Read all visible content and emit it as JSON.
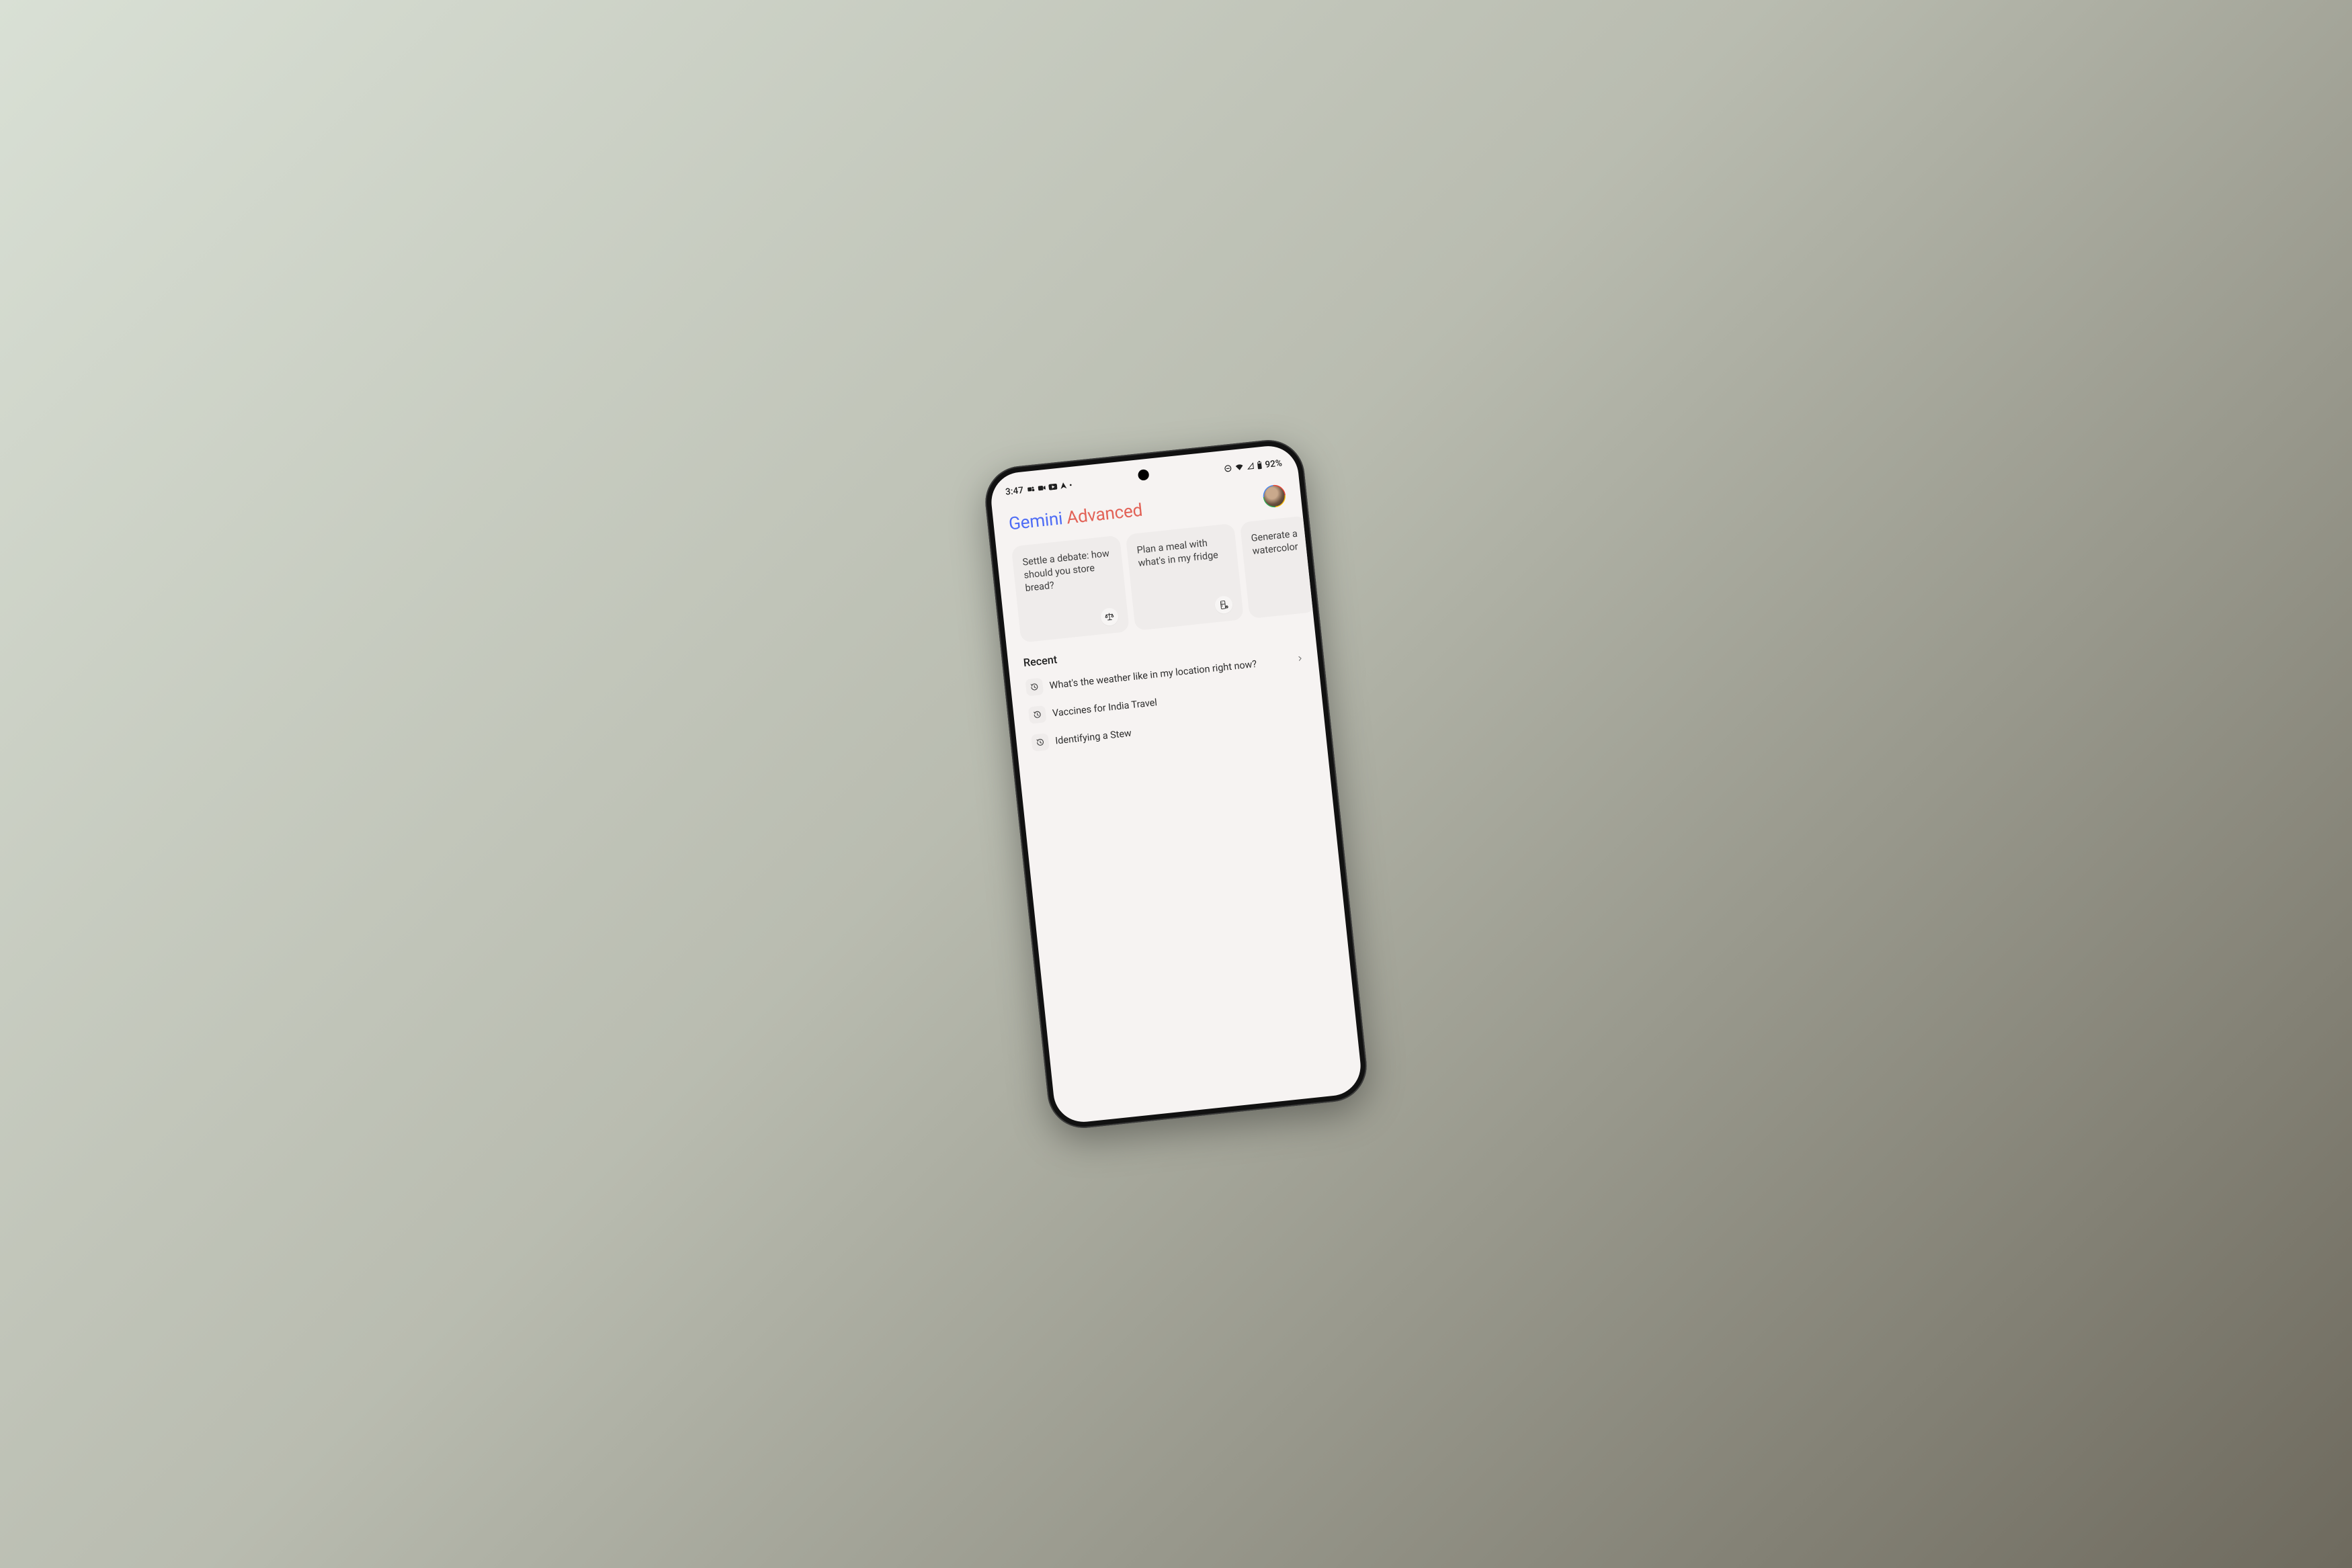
{
  "status": {
    "time": "3:47",
    "battery_text": "92%"
  },
  "header": {
    "title_primary": "Gemini",
    "title_secondary": "Advanced"
  },
  "cards": [
    {
      "text": "Settle a debate: how should you store bread?",
      "icon": "scale"
    },
    {
      "text": "Plan a meal with what's in my fridge",
      "icon": "fridge"
    },
    {
      "text": "Generate a watercolor",
      "icon": "art"
    }
  ],
  "recent": {
    "label": "Recent",
    "items": [
      "What's the weather like in my location right now?",
      "Vaccines for India Travel",
      "Identifying a Stew"
    ]
  }
}
